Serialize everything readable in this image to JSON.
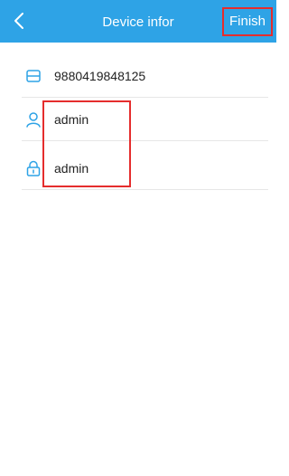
{
  "header": {
    "title": "Device infor",
    "finish_label": "Finish"
  },
  "fields": [
    {
      "icon": "device-id-icon",
      "value": "9880419848125"
    },
    {
      "icon": "user-icon",
      "value": "admin"
    },
    {
      "icon": "lock-icon",
      "value": "admin"
    }
  ],
  "colors": {
    "header_bg": "#2ea3e6",
    "icon_blue": "#2ea3e6",
    "highlight": "#e52d2d"
  }
}
